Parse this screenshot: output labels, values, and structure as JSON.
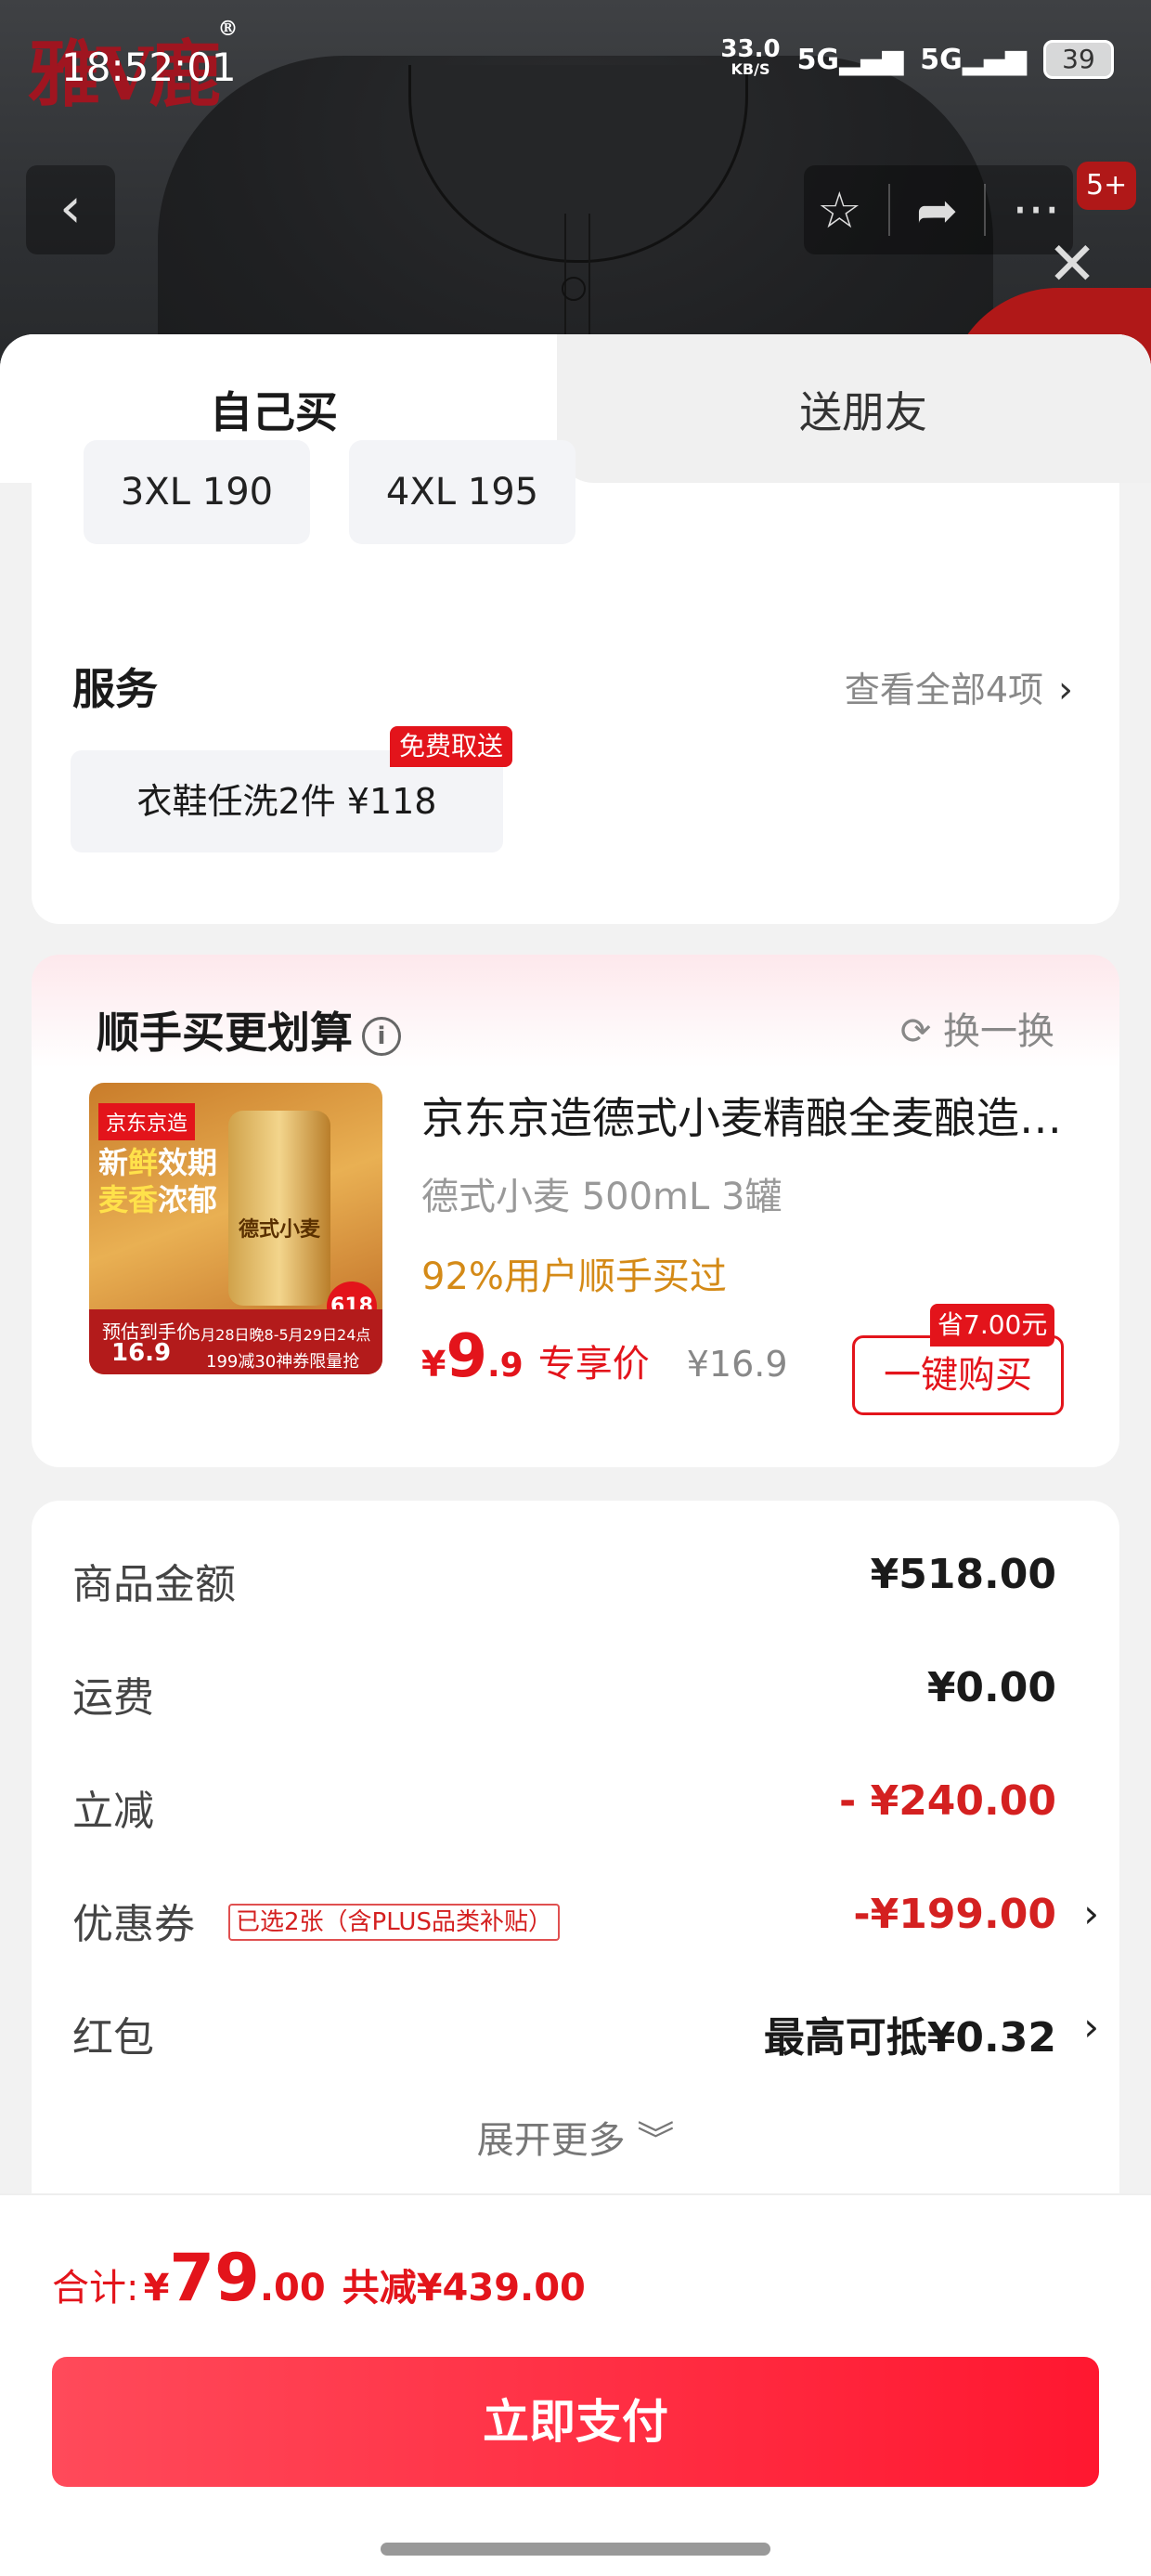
{
  "status_bar": {
    "time": "18:52:01",
    "net_speed": "33.0",
    "net_unit": "KB/S",
    "signal1": "5G",
    "signal2": "5G",
    "battery": "39"
  },
  "hero": {
    "brand_logo": "雅V鹿",
    "cart_badge": "5+"
  },
  "tabs": {
    "self": "自己买",
    "friend": "送朋友"
  },
  "sizes": [
    {
      "label": "3XL 190"
    },
    {
      "label": "4XL 195"
    }
  ],
  "service": {
    "title": "服务",
    "view_all": "查看全部4项",
    "chip_label": "衣鞋任洗2件  ¥118",
    "chip_tag": "免费取送"
  },
  "addon": {
    "title": "顺手买更划算",
    "swap": "换一换",
    "product_name": "京东京造德式小麦精酿全麦酿造啤酒",
    "spec": "德式小麦 500mL 3罐",
    "rate": "92%用户顺手买过",
    "price_symbol": "¥",
    "price_int": "9",
    "price_dec": ".9",
    "exclusive": "专享价",
    "orig_price": "¥16.9",
    "save_tag": "省7.00元",
    "buy_button": "一键购买",
    "image": {
      "brand": "京东京造",
      "fresh1a": "新",
      "fresh1b": "鲜",
      "fresh1c": "效期",
      "fresh2a": "麦香",
      "fresh2b": "浓郁",
      "can_label": "德式小麦",
      "strip1": "预估到手价",
      "strip2": "16.9",
      "strip3": "5月28日晚8-5月29日24点",
      "strip4": "199减30神券限量抢",
      "badge": "618"
    }
  },
  "summary": {
    "rows": [
      {
        "label": "商品金额",
        "value": "¥518.00"
      },
      {
        "label": "运费",
        "value": "¥0.00"
      },
      {
        "label": "立减",
        "value": "- ¥240.00"
      },
      {
        "label": "优惠券",
        "tag": "已选2张（含PLUS品类补贴）",
        "value": "-¥199.00"
      },
      {
        "label": "红包",
        "value": "最高可抵¥0.32"
      }
    ],
    "expand": "展开更多 ︾"
  },
  "bottom": {
    "total_label": "合计:",
    "symbol": "¥",
    "total_int": "79",
    "total_dec": ".00",
    "total_saved": "共减¥439.00",
    "pay_button": "立即支付"
  },
  "colors": {
    "accent_red": "#e3141b",
    "pay_gradient_start": "#ff4a5a",
    "pay_gradient_end": "#ff1730"
  }
}
